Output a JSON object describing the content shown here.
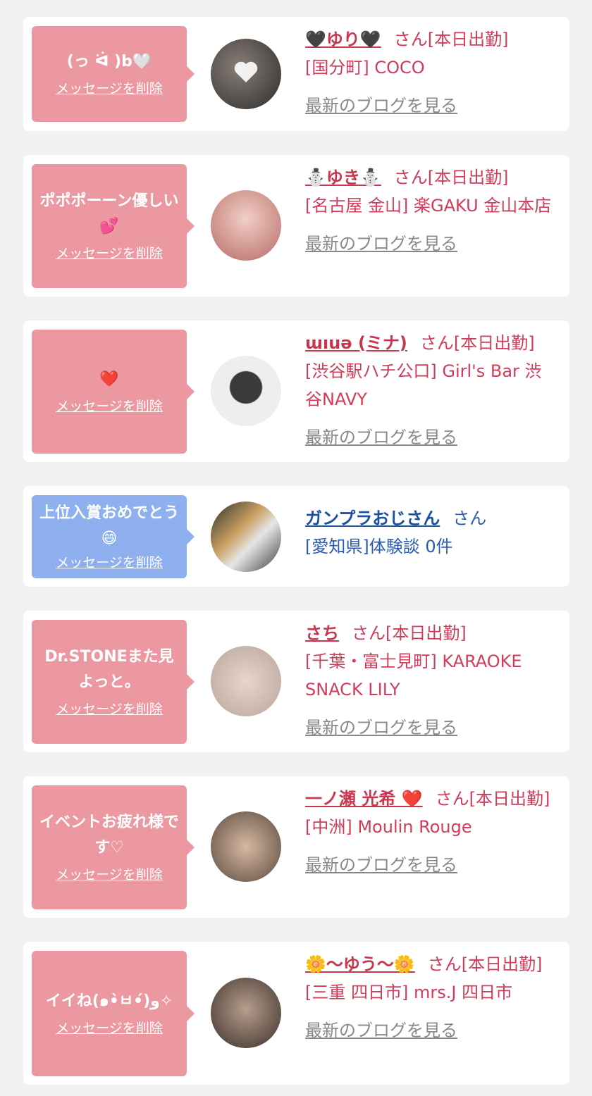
{
  "delete_label": "メッセージを削除",
  "blog_label": "最新のブログを見る",
  "cards": [
    {
      "message": "(っ ᐛ )b🤍",
      "name": "🖤ゆり🖤",
      "suffix": "さん[本日出勤]",
      "shop": "[国分町] COCO",
      "bubble_color": "#eb98a1",
      "avatar_colors": [
        "#2b2b2b",
        "#8a7f78"
      ]
    },
    {
      "message": "ポポポーーン優しい💕",
      "name": "⛄ゆき⛄",
      "suffix": "さん[本日出勤]",
      "shop": "[名古屋 金山] 楽GAKU 金山本店",
      "bubble_color": "#eb98a1",
      "avatar_colors": [
        "#e8b3a8",
        "#b76a66"
      ]
    },
    {
      "message": "❤️",
      "name": "ɯıuǝ (ミナ)",
      "suffix": "さん[本日出勤]",
      "shop": "[渋谷駅ハチ公口] Girl's Bar 渋谷NAVY",
      "bubble_color": "#eb98a1",
      "avatar_colors": [
        "#eeeeee",
        "#3a3a3a"
      ]
    },
    {
      "message": "上位入賞おめでとう😄",
      "name": "ガンプラおじさん",
      "suffix": "さん",
      "shop": "[愛知県]体験談 0件",
      "bubble_color": "#8fb0ee",
      "avatar_colors": [
        "#3b3b3b",
        "#c9a060"
      ]
    },
    {
      "message": "Dr.STONEまた見よっと。",
      "name": "さち",
      "suffix": "さん[本日出勤]",
      "shop": "[千葉・富士見町] KARAOKE SNACK LILY",
      "bubble_color": "#eb98a1",
      "avatar_colors": [
        "#b8a49a",
        "#e7d6cf"
      ]
    },
    {
      "message": "イベントお疲れ様です♡",
      "name": "一ノ瀬 光希 ❤️",
      "suffix": "さん[本日出勤]",
      "shop": "[中洲] Moulin Rouge",
      "bubble_color": "#eb98a1",
      "avatar_colors": [
        "#5a4a3e",
        "#d8b9a2"
      ]
    },
    {
      "message": "イイね(๑•̀ㅂ•́)و✧",
      "name": "🌼〜ゆう〜🌼",
      "suffix": "さん[本日出勤]",
      "shop": "[三重 四日市] mrs.J 四日市",
      "bubble_color": "#eb98a1",
      "avatar_colors": [
        "#3a2f2a",
        "#b79e8c"
      ]
    }
  ]
}
